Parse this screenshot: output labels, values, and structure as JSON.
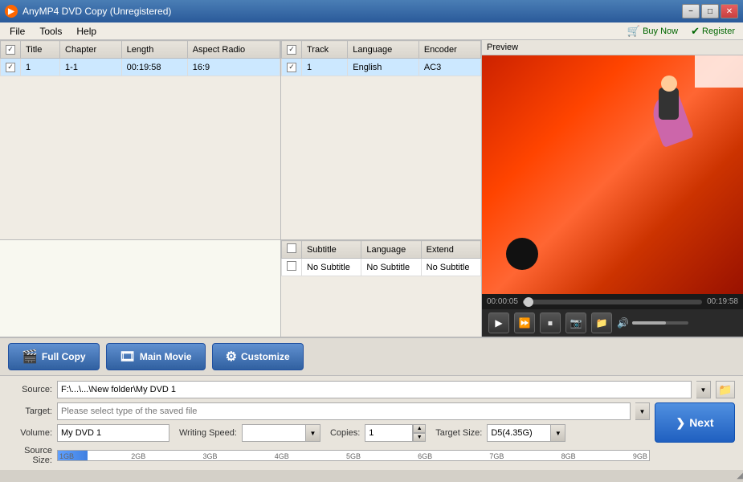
{
  "app": {
    "title": "AnyMP4 DVD Copy (Unregistered)",
    "buy_now": "Buy Now",
    "register": "Register"
  },
  "menu": {
    "file": "File",
    "tools": "Tools",
    "help": "Help"
  },
  "window_controls": {
    "minimize": "−",
    "maximize": "□",
    "close": "✕"
  },
  "main_table": {
    "headers": [
      "",
      "Title",
      "Chapter",
      "Length",
      "Aspect Radio"
    ],
    "rows": [
      {
        "checked": true,
        "title": "1",
        "chapter": "1-1",
        "length": "00:19:58",
        "aspect": "16:9"
      }
    ]
  },
  "audio_table": {
    "headers": [
      "",
      "Track",
      "Language",
      "Encoder"
    ],
    "rows": [
      {
        "checked": true,
        "track": "1",
        "language": "English",
        "encoder": "AC3"
      }
    ]
  },
  "subtitle_table": {
    "headers": [
      "",
      "Subtitle",
      "Language",
      "Extend"
    ],
    "rows": [
      {
        "checked": false,
        "subtitle": "No Subtitle",
        "language": "No Subtitle",
        "extend": "No Subtitle"
      }
    ]
  },
  "preview": {
    "label": "Preview"
  },
  "timeline": {
    "current_time": "00:00:05",
    "total_time": "00:19:58"
  },
  "mode_buttons": {
    "full_copy": "Full Copy",
    "main_movie": "Main Movie",
    "customize": "Customize"
  },
  "source": {
    "label": "Source:",
    "value": "F:\\...\\...\\New folder\\My DVD 1",
    "placeholder": "F:\\...\\...\\New folder\\My DVD 1"
  },
  "target": {
    "label": "Target:",
    "placeholder": "Please select type of the saved file"
  },
  "volume": {
    "label": "Volume:",
    "value": "My DVD 1"
  },
  "writing_speed": {
    "label": "Writing Speed:",
    "value": ""
  },
  "copies": {
    "label": "Copies:",
    "value": "1"
  },
  "target_size": {
    "label": "Target Size:",
    "value": "D5(4.35G)"
  },
  "source_size": {
    "label": "Source Size:",
    "markers": [
      "1GB",
      "2GB",
      "3GB",
      "4GB",
      "5GB",
      "6GB",
      "7GB",
      "8GB",
      "9GB"
    ]
  },
  "next_button": {
    "label": "Next",
    "arrow": "❯"
  }
}
